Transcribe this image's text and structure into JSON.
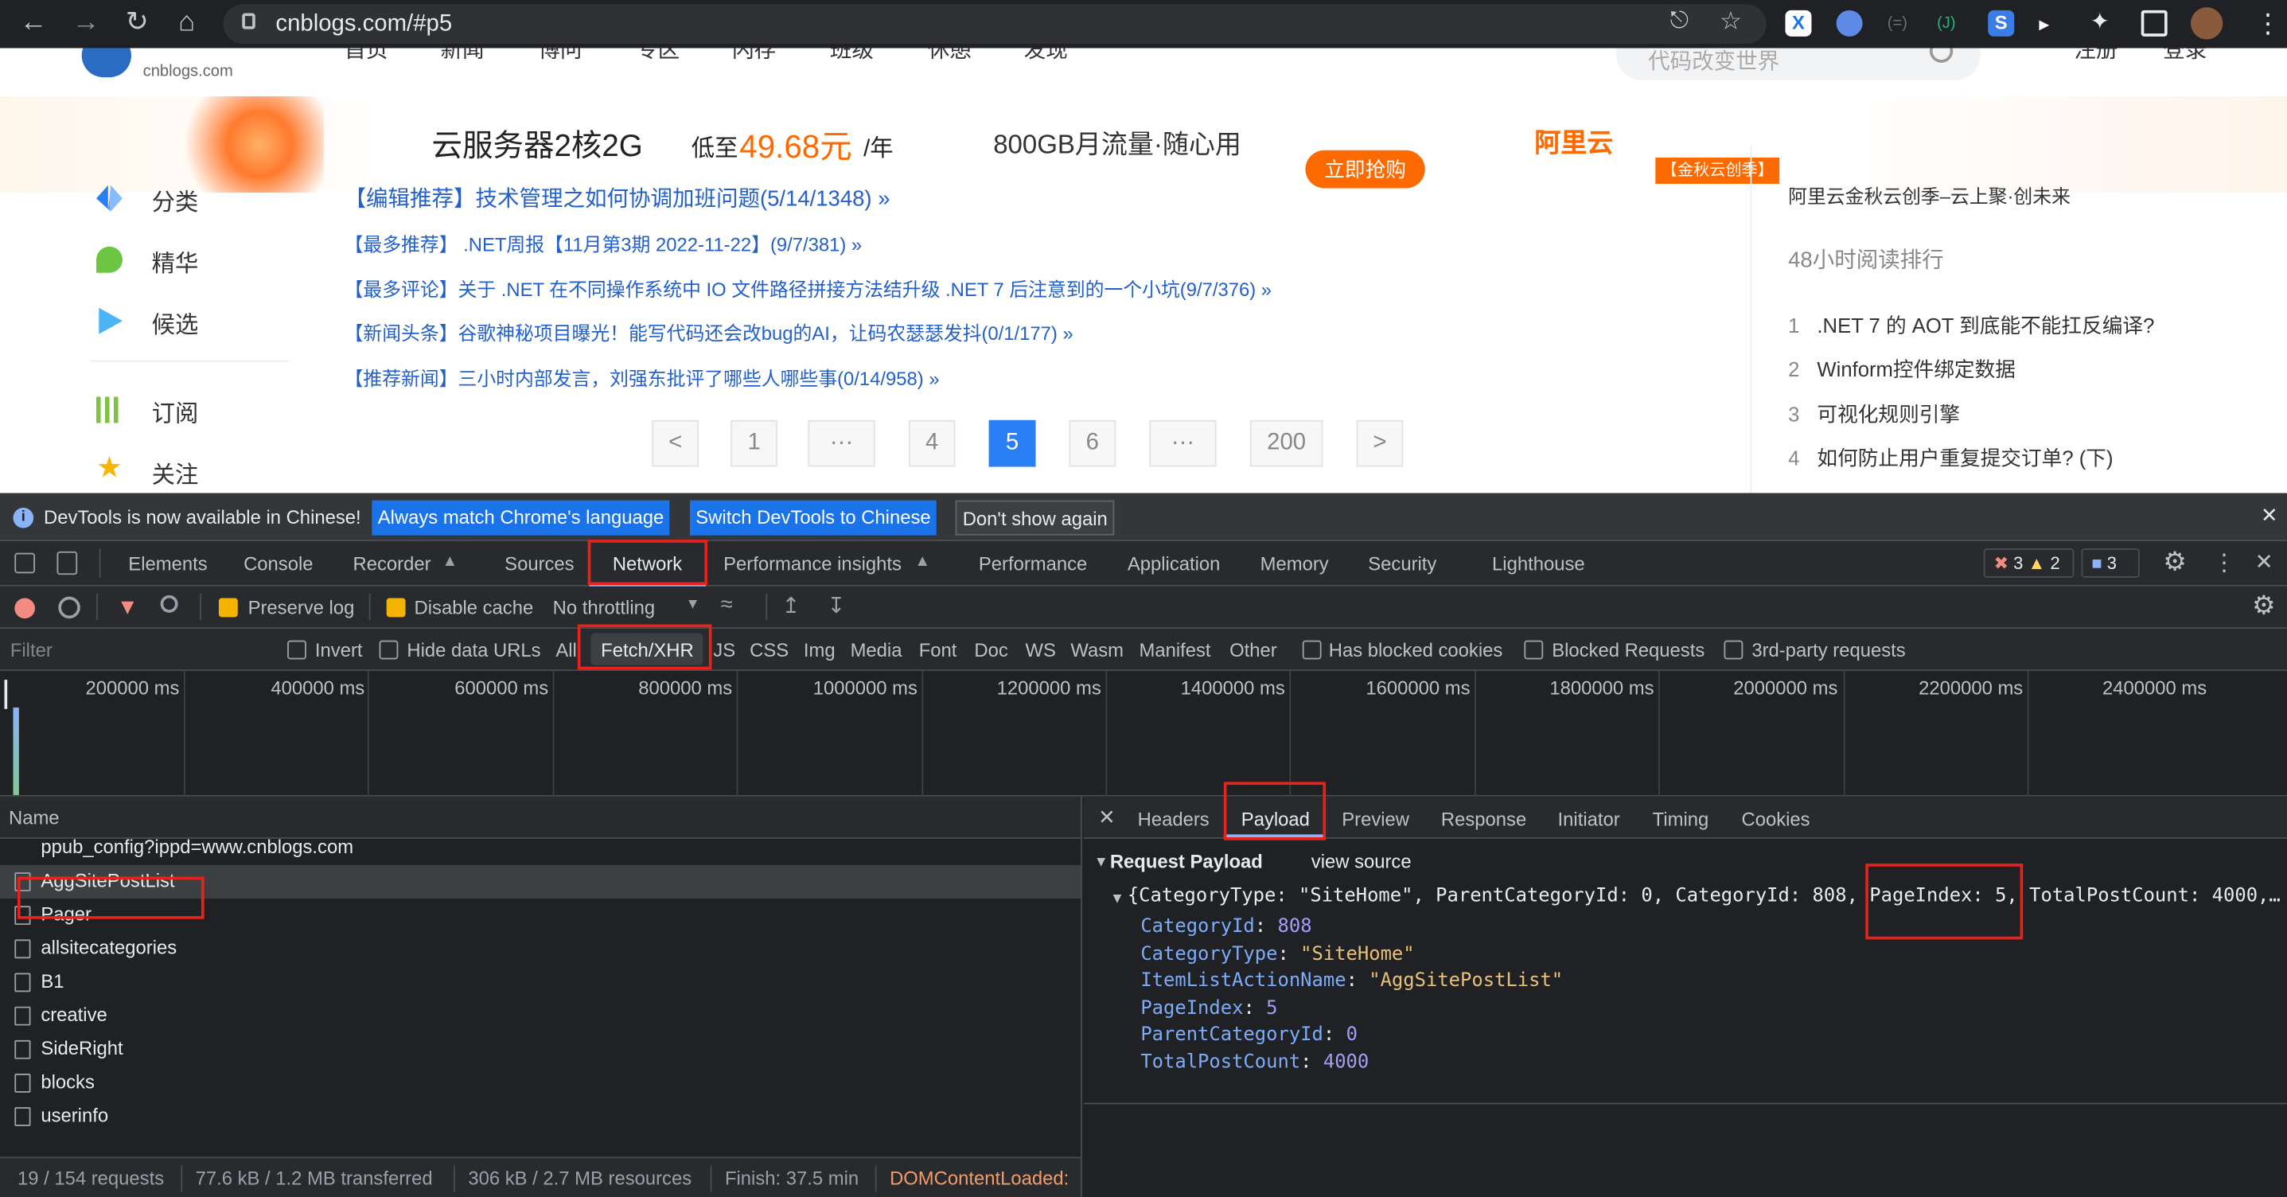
{
  "browser": {
    "url": "cnblogs.com/#p5"
  },
  "site": {
    "logo_sub": "cnblogs.com",
    "nav": [
      "首页",
      "新闻",
      "博问",
      "专区",
      "闪存",
      "班级",
      "休憩",
      "发现"
    ],
    "search_placeholder": "代码改变世界",
    "auth": [
      "注册",
      "登录"
    ],
    "banner": {
      "title": "云服务器2核2G",
      "price_prefix": "低至",
      "price": "49.68元",
      "price_suffix": "/年",
      "traffic": "800GB月流量·随心用",
      "cta": "立即抢购",
      "brand": "阿里云",
      "campaign": "【金秋云创季】"
    },
    "sidebar": [
      "分类",
      "精华",
      "候选",
      "订阅",
      "关注"
    ],
    "recommend": [
      "【编辑推荐】技术管理之如何协调加班问题(5/14/1348) »",
      "【最多推荐】 .NET周报【11月第3期 2022-11-22】(9/7/381) »",
      "【最多评论】关于 .NET 在不同操作系统中 IO 文件路径拼接方法结升级 .NET 7 后注意到的一个小坑(9/7/376) »",
      "【新闻头条】谷歌神秘项目曝光！能写代码还会改bug的AI，让码农瑟瑟发抖(0/1/177) »",
      "【推荐新闻】三小时内部发言，刘强东批评了哪些人哪些事(0/14/958) »"
    ],
    "pager": [
      "<",
      "1",
      "···",
      "4",
      "5",
      "6",
      "···",
      "200",
      ">"
    ],
    "pager_current": "5",
    "right": {
      "ad": "阿里云金秋云创季–云上聚·创未来",
      "rank_title": "48小时阅读排行",
      "rank": [
        {
          "n": "1",
          "t": ".NET 7 的 AOT 到底能不能扛反编译?"
        },
        {
          "n": "2",
          "t": "Winform控件绑定数据"
        },
        {
          "n": "3",
          "t": "可视化规则引擎"
        },
        {
          "n": "4",
          "t": "如何防止用户重复提交订单?  (下)"
        }
      ]
    }
  },
  "devtools": {
    "info": {
      "text": "DevTools is now available in Chinese!",
      "btn1": "Always match Chrome's language",
      "btn2": "Switch DevTools to Chinese",
      "btn3": "Don't show again"
    },
    "tabs": [
      "Elements",
      "Console",
      "Recorder",
      "Sources",
      "Network",
      "Performance insights",
      "Performance",
      "Application",
      "Memory",
      "Security",
      "Lighthouse"
    ],
    "counts": {
      "errors": "3",
      "warnings": "2",
      "messages": "3"
    },
    "toolbar": {
      "preserve_log": "Preserve log",
      "disable_cache": "Disable cache",
      "throttling": "No throttling"
    },
    "filter": {
      "placeholder": "Filter",
      "invert": "Invert",
      "hide_data_urls": "Hide data URLs",
      "types": [
        "All",
        "Fetch/XHR",
        "JS",
        "CSS",
        "Img",
        "Media",
        "Font",
        "Doc",
        "WS",
        "Wasm",
        "Manifest",
        "Other"
      ],
      "has_blocked": "Has blocked cookies",
      "blocked_requests": "Blocked Requests",
      "third_party": "3rd-party requests"
    },
    "timeline": [
      "200000 ms",
      "400000 ms",
      "600000 ms",
      "800000 ms",
      "1000000 ms",
      "1200000 ms",
      "1400000 ms",
      "1600000 ms",
      "1800000 ms",
      "2000000 ms",
      "2200000 ms",
      "2400000 ms"
    ],
    "name_header": "Name",
    "requests": [
      "ppub_config?ippd=www.cnblogs.com",
      "AggSitePostList",
      "Pager",
      "allsitecategories",
      "B1",
      "creative",
      "SideRight",
      "blocks",
      "userinfo"
    ],
    "status": {
      "requests": "19 / 154 requests",
      "transferred": "77.6 kB / 1.2 MB transferred",
      "resources": "306 kB / 2.7 MB resources",
      "finish": "Finish: 37.5 min",
      "dom": "DOMContentLoaded:"
    },
    "detail_tabs": [
      "Headers",
      "Payload",
      "Preview",
      "Response",
      "Initiator",
      "Timing",
      "Cookies"
    ],
    "payload": {
      "section": "Request Payload",
      "view_source": "view source",
      "summary": "{CategoryType: \"SiteHome\", ParentCategoryId: 0, CategoryId: 808, PageIndex: 5, TotalPostCount: 4000,…",
      "fields": [
        {
          "k": "CategoryId",
          "v": "808",
          "t": "num"
        },
        {
          "k": "CategoryType",
          "v": "\"SiteHome\"",
          "t": "str"
        },
        {
          "k": "ItemListActionName",
          "v": "\"AggSitePostList\"",
          "t": "str"
        },
        {
          "k": "PageIndex",
          "v": "5",
          "t": "num"
        },
        {
          "k": "ParentCategoryId",
          "v": "0",
          "t": "num"
        },
        {
          "k": "TotalPostCount",
          "v": "4000",
          "t": "num"
        }
      ]
    }
  }
}
